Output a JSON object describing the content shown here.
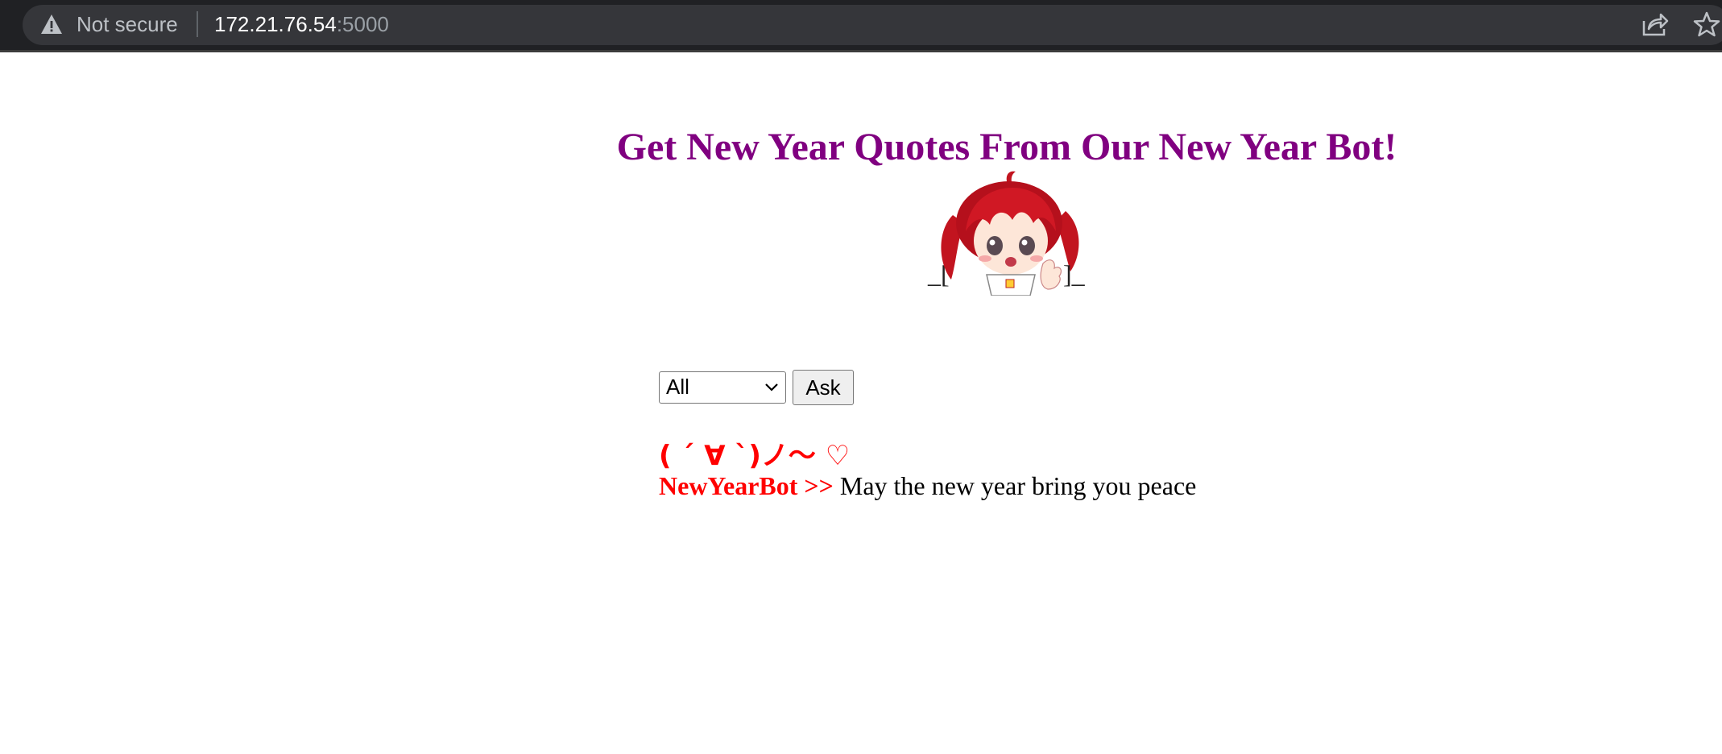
{
  "browser": {
    "security_label": "Not secure",
    "url_host": "172.21.76.54",
    "url_port": ":5000",
    "icons": [
      "warning-icon",
      "share-icon",
      "star-icon"
    ]
  },
  "page": {
    "title": "Get New Year Quotes From Our New Year Bot!",
    "bracket_left": "_[",
    "bracket_right": "]_",
    "select": {
      "selected": "All"
    },
    "ask_label": "Ask",
    "kaomoji": "( ´ ∀ `)ノ～ ♡",
    "bot_name": "NewYearBot >>",
    "bot_message": "May the new year bring you peace"
  },
  "colors": {
    "title": "#800080",
    "bot": "#ff0000",
    "chrome_bg": "#202124"
  }
}
